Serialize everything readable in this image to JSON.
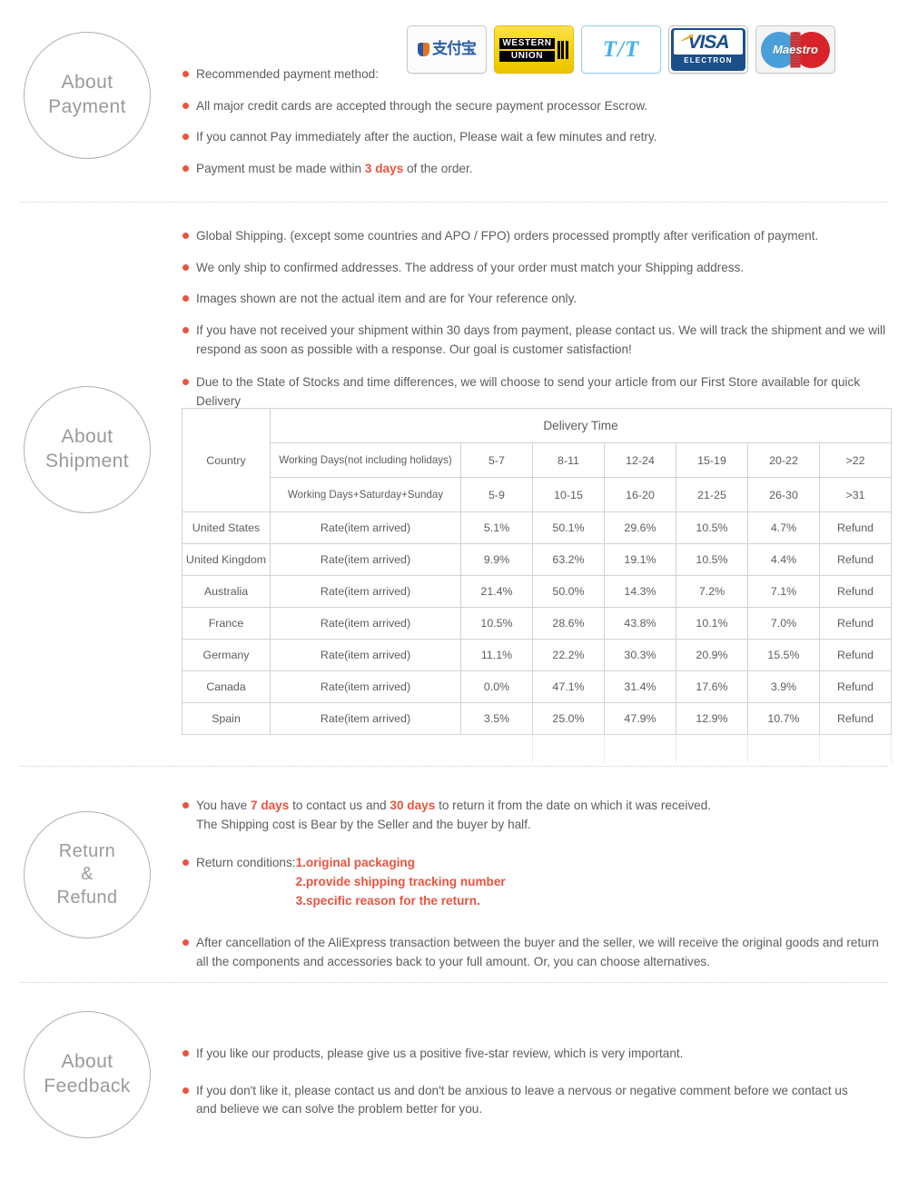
{
  "colors": {
    "accent": "#e8543f",
    "text": "#5d5d5d",
    "badge_border": "#b0b0b0",
    "table_border": "#d2d2d2"
  },
  "sections": {
    "payment": {
      "badge": {
        "line1": "About",
        "line2": "Payment"
      },
      "bullets": [
        {
          "text": "Recommended payment method:"
        },
        {
          "text": "All major credit cards are accepted through the secure payment processor Escrow."
        },
        {
          "text": "If you cannot Pay immediately after the auction, Please wait a few minutes and retry."
        },
        {
          "pre": "Payment must be made within ",
          "hl": "3 days",
          "post": " of the order."
        }
      ],
      "logos": [
        {
          "name": "alipay-logo",
          "label": "Alipay",
          "zh": "支付宝"
        },
        {
          "name": "western-union-logo",
          "label": "Western Union",
          "line1": "WESTERN",
          "line2": "UNION"
        },
        {
          "name": "tt-logo",
          "label": "T/T",
          "text": "T/T"
        },
        {
          "name": "visa-electron-logo",
          "label": "Visa Electron",
          "word": "VISA",
          "sub": "ELECTRON"
        },
        {
          "name": "maestro-logo",
          "label": "Maestro",
          "word": "Maestro"
        }
      ]
    },
    "shipment": {
      "badge": {
        "line1": "About",
        "line2": "Shipment"
      },
      "bullets": [
        {
          "text": "Global Shipping. (except some countries and APO / FPO) orders processed promptly after verification of payment."
        },
        {
          "text": "We only ship to confirmed addresses. The address of your order must match your Shipping address."
        },
        {
          "text": "Images shown are not the actual item and are for Your reference only."
        },
        {
          "text": "If you have not received your shipment within 30 days from payment, please contact us. We will track the shipment and we will respond as soon as possible with a response. Our goal is customer satisfaction!"
        },
        {
          "text": "Due to the State of Stocks and time differences, we will choose to send your article from our First Store available for quick Delivery"
        }
      ]
    },
    "return": {
      "badge": {
        "line1": "Return",
        "line2": "&",
        "line3": "Refund"
      },
      "bullets": [
        {
          "pre": "You have ",
          "hl": "7 days",
          "mid": " to contact us and ",
          "hl2": "30 days",
          "post": " to return it from the date on which it was received.",
          "line2": "The Shipping cost is Bear by the Seller and the buyer by half."
        },
        {
          "label": "Return conditions:",
          "conditions": [
            "1.original packaging",
            "2.provide shipping tracking number",
            "3.specific reason for the return."
          ]
        },
        {
          "text": "After cancellation of the AliExpress transaction between the buyer and the seller, we will receive the original goods and return all the components and accessories back to your full amount. Or, you can choose alternatives."
        }
      ]
    },
    "feedback": {
      "badge": {
        "line1": "About",
        "line2": "Feedback"
      },
      "bullets": [
        {
          "text": "If you like our products, please give us a positive five-star review, which is very important."
        },
        {
          "text": "If you don't like it, please contact us and don't be anxious to leave a nervous or negative comment before we contact us and believe we can solve the problem better for you."
        }
      ]
    }
  },
  "delivery_table": {
    "col_country": "Country",
    "title": "Delivery Time",
    "mode_rows": [
      {
        "mode": "Working Days(not including holidays)",
        "values": [
          "5-7",
          "8-11",
          "12-24",
          "15-19",
          "20-22",
          ">22"
        ]
      },
      {
        "mode": "Working Days+Saturday+Sunday",
        "values": [
          "5-9",
          "10-15",
          "16-20",
          "21-25",
          "26-30",
          ">31"
        ]
      }
    ],
    "rate_label": "Rate(item arrived)",
    "rows": [
      {
        "country": "United States",
        "values": [
          "5.1%",
          "50.1%",
          "29.6%",
          "10.5%",
          "4.7%",
          "Refund"
        ]
      },
      {
        "country": "United Kingdom",
        "values": [
          "9.9%",
          "63.2%",
          "19.1%",
          "10.5%",
          "4.4%",
          "Refund"
        ]
      },
      {
        "country": "Australia",
        "values": [
          "21.4%",
          "50.0%",
          "14.3%",
          "7.2%",
          "7.1%",
          "Refund"
        ]
      },
      {
        "country": "France",
        "values": [
          "10.5%",
          "28.6%",
          "43.8%",
          "10.1%",
          "7.0%",
          "Refund"
        ]
      },
      {
        "country": "Germany",
        "values": [
          "11.1%",
          "22.2%",
          "30.3%",
          "20.9%",
          "15.5%",
          "Refund"
        ]
      },
      {
        "country": "Canada",
        "values": [
          "0.0%",
          "47.1%",
          "31.4%",
          "17.6%",
          "3.9%",
          "Refund"
        ]
      },
      {
        "country": "Spain",
        "values": [
          "3.5%",
          "25.0%",
          "47.9%",
          "12.9%",
          "10.7%",
          "Refund"
        ]
      }
    ]
  }
}
